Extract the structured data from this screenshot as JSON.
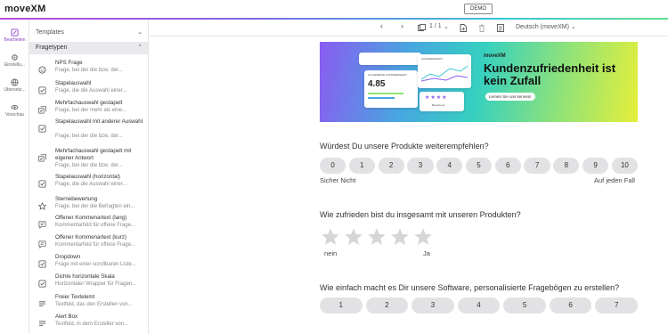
{
  "app": {
    "logo": "moveXM",
    "demo_label": "DEMO"
  },
  "rail": [
    {
      "label": "Bearbeiten",
      "icon": "edit-icon"
    },
    {
      "label": "Einstellu...",
      "icon": "gear-icon"
    },
    {
      "label": "Übersetz...",
      "icon": "globe-icon"
    },
    {
      "label": "Vorschau",
      "icon": "eye-icon"
    }
  ],
  "panel": {
    "templates_label": "Templates",
    "fragetypen_label": "Fragetypen",
    "items": [
      {
        "title": "NPS Frage",
        "desc": "Frage, bei der die bzw. der...",
        "icon": "smiley-icon"
      },
      {
        "title": "Stapelauswahl",
        "desc": "Frage, die die Auswahl einer...",
        "icon": "checkbox-icon"
      },
      {
        "title": "Mehrfachauswahl gestapelt",
        "desc": "Frage, bei der mehr als eine...",
        "icon": "multi-checkbox-icon"
      },
      {
        "title": "Stapelauswahl mit anderer Auswahl",
        "desc": "Frage, bei der die bzw. der...",
        "icon": "checkbox-icon"
      },
      {
        "title": "Mehrfachauswahl gestapelt mit eigener Antwort",
        "desc": "Frage, bei der die bzw. der...",
        "icon": "multi-checkbox-icon"
      },
      {
        "title": "Stapelauswahl (horizontal)",
        "desc": "Frage, die die Auswahl einer...",
        "icon": "checkbox-icon"
      },
      {
        "title": "Sternebewertung",
        "desc": "Frage, bei der die Befragten ein...",
        "icon": "star-icon"
      },
      {
        "title": "Offener Kommenartext (lang)",
        "desc": "Kommentarfeld für offene Frage...",
        "icon": "comment-icon"
      },
      {
        "title": "Offener Kommenartext (kurz)",
        "desc": "Kommentarfeld für offene Frage...",
        "icon": "comment-icon"
      },
      {
        "title": "Dropdown",
        "desc": "Frage mit einer scrollbaren Liste...",
        "icon": "checkbox-icon"
      },
      {
        "title": "Dichte horizontale Skala",
        "desc": "Horizontaler Wrapper für Fragen...",
        "icon": "checkbox-icon"
      },
      {
        "title": "Freier Textelemt",
        "desc": "Textfeld, das den Erstellen von...",
        "icon": "text-icon"
      },
      {
        "title": "Alert Box",
        "desc": "Textfeld, in dem Ersteller von...",
        "icon": "text-icon"
      }
    ]
  },
  "toolbar": {
    "page_indicator": "1 / 1",
    "language": "Deutsch (moveXM)"
  },
  "banner": {
    "brand": "moveXM",
    "headline": "Kundenzufriedenheit ist kein Zufall",
    "cta": "Lernen Sie uns kennen!",
    "mock_label_1": "ALLGEMEINE ZUFRIEDENHEIT",
    "mock_value": "4.85",
    "mock_label_2": "ZUFRIEDENHEIT",
    "mock_label_3": "Bewertung"
  },
  "questions": {
    "q1": {
      "title": "Würdest Du unsere Produkte weiterempfehlen?",
      "options": [
        "0",
        "1",
        "2",
        "3",
        "4",
        "5",
        "6",
        "7",
        "8",
        "9",
        "10"
      ],
      "left_anchor": "Sicher Nicht",
      "right_anchor": "Auf jeden Fall"
    },
    "q2": {
      "title": "Wie zufrieden bist du insgesamt mit unseren Produkten?",
      "stars": 5,
      "left_anchor": "nein",
      "right_anchor": "Ja"
    },
    "q3": {
      "title": "Wie einfach macht es Dir unsere Software, personalisierte Fragebögen zu erstellen?",
      "options": [
        "1",
        "2",
        "3",
        "4",
        "5",
        "6",
        "7"
      ]
    }
  },
  "colors": {
    "accent": "#c56fe8",
    "pill": "#e2e2e4",
    "star": "#d6d6d6"
  }
}
